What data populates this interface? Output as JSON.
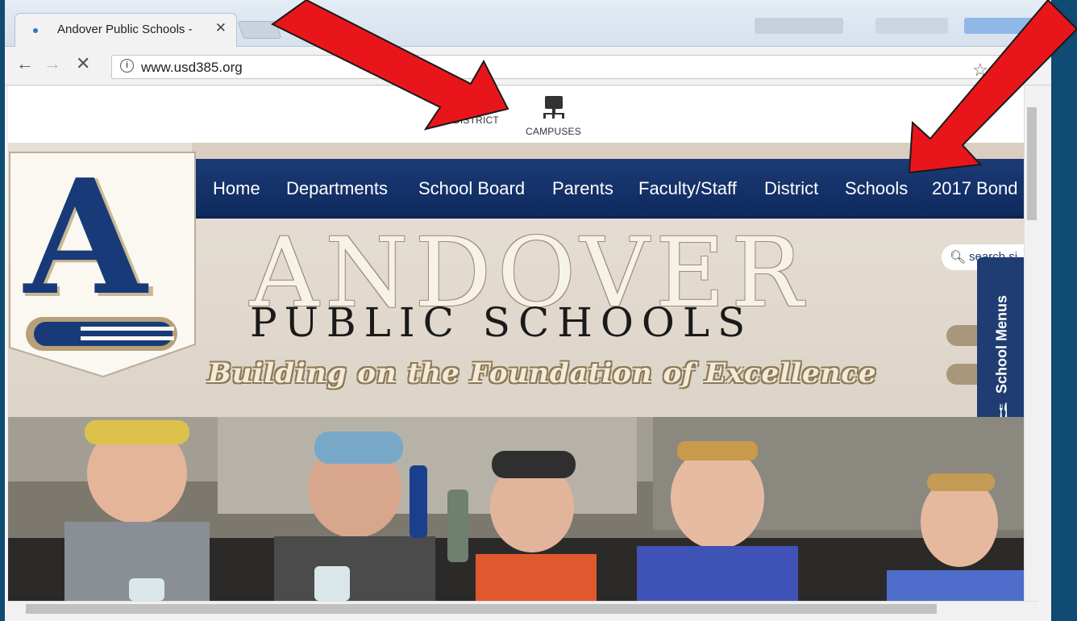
{
  "browser": {
    "tab_title": "Andover Public Schools -",
    "tab_close": "✕",
    "url": "www.usd385.org",
    "back_icon": "←",
    "forward_icon": "→",
    "stop_icon": "✕",
    "info_icon": "i",
    "star_icon": "☆"
  },
  "page": {
    "utility_links": [
      "DISTRICT",
      "CAMPUSES"
    ],
    "nav_items": [
      "Home",
      "Departments",
      "School Board",
      "Parents",
      "Faculty/Staff",
      "District",
      "Schools",
      "2017 Bond"
    ],
    "title_line1": "ANDOVER",
    "title_line2": "PUBLIC SCHOOLS",
    "tagline": "Building on the Foundation of Excellence",
    "search_placeholder": "search si",
    "school_menus": "School Menus",
    "logo_letter": "A"
  },
  "colors": {
    "nav_blue": "#1c3a75",
    "beige": "#e7e0d6",
    "gold": "#a8977b",
    "arrow_red": "#e8161b",
    "frame_blue": "#0f4b73"
  }
}
